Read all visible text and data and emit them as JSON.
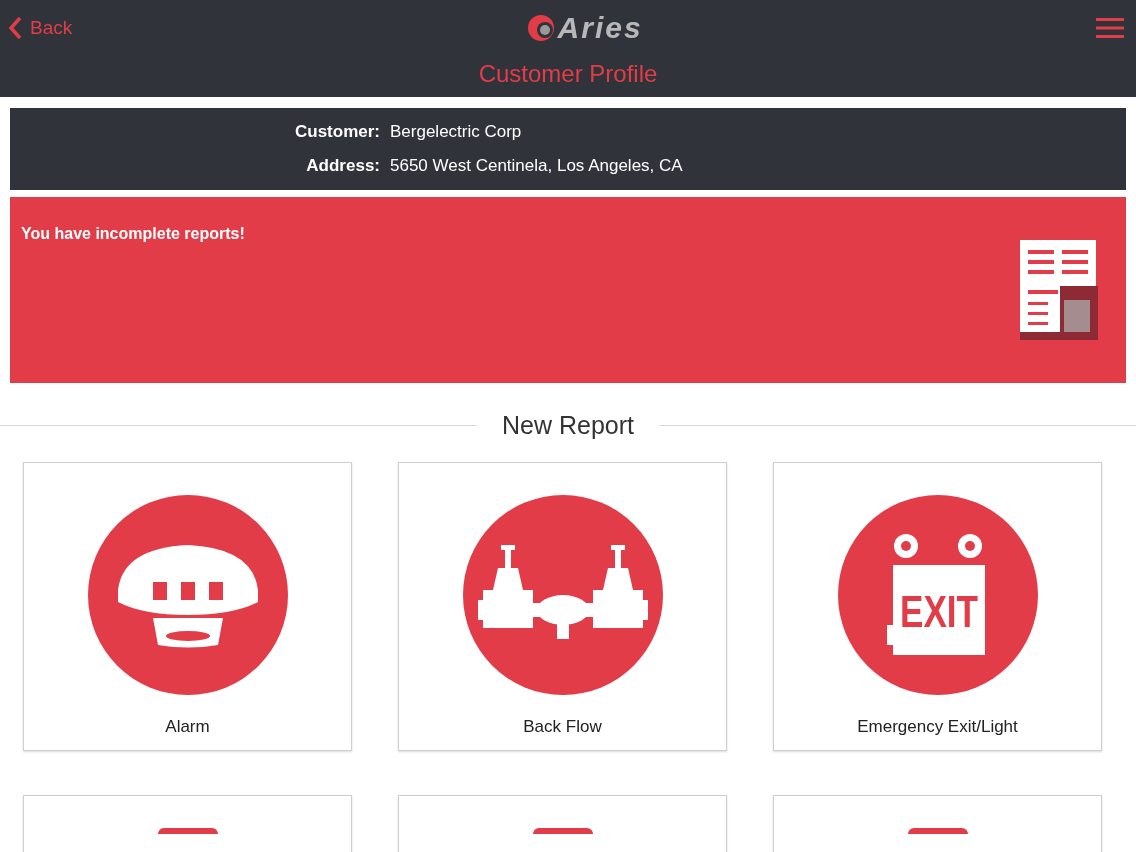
{
  "header": {
    "back_label": "Back",
    "logo_text": "Aries",
    "title": "Customer Profile"
  },
  "customer_info": [
    {
      "label": "Customer:",
      "value": "Bergelectric Corp"
    },
    {
      "label": "Address:",
      "value": "5650 West Centinela, Los Angeles, CA"
    }
  ],
  "alert": {
    "message": "You have incomplete reports!"
  },
  "section_title": "New Report",
  "report_types": [
    {
      "kind": "alarm",
      "label": "Alarm"
    },
    {
      "kind": "backflow",
      "label": "Back Flow"
    },
    {
      "kind": "exit",
      "label": "Emergency Exit/Light",
      "sign_text": "EXIT"
    }
  ]
}
